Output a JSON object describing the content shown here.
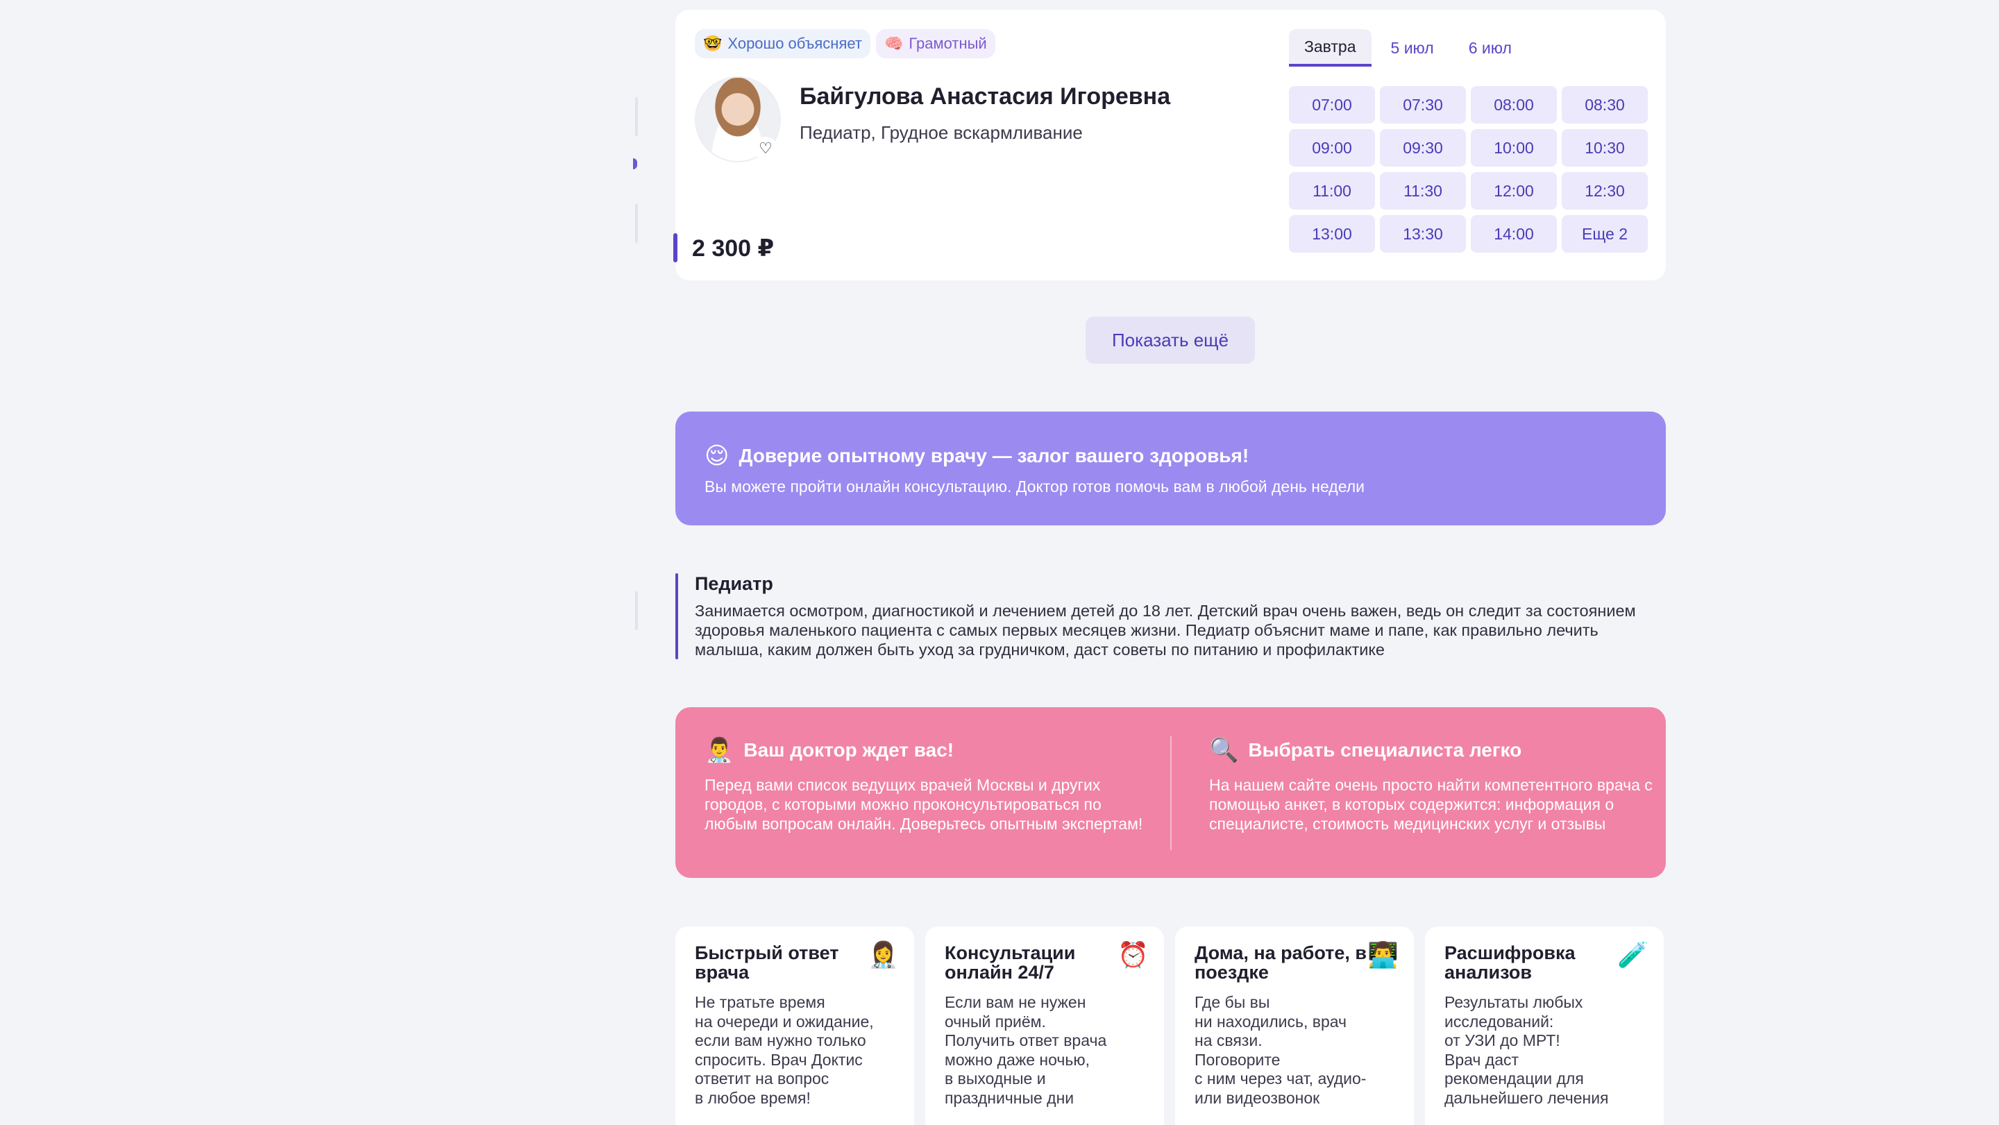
{
  "doctor": {
    "badges": [
      {
        "emoji": "🤓",
        "label": "Хорошо объясняет"
      },
      {
        "emoji": "🧠",
        "label": "Грамотный"
      }
    ],
    "name": "Байгулова Анастасия Игоревна",
    "specialty": "Педиатр, Грудное вскармливание",
    "price": "2 300 ₽",
    "favorite_icon": "heart-outline-icon",
    "tabs": [
      "Завтра",
      "5 июл",
      "6 июл"
    ],
    "active_tab": "Завтра",
    "slots": [
      "07:00",
      "07:30",
      "08:00",
      "08:30",
      "09:00",
      "09:30",
      "10:00",
      "10:30",
      "11:00",
      "11:30",
      "12:00",
      "12:30",
      "13:00",
      "13:30",
      "14:00",
      "Еще 2"
    ]
  },
  "show_more_label": "Показать ещё",
  "trust": {
    "emoji": "😌",
    "title": "Доверие опытному врачу — залог вашего здоровья!",
    "text": "Вы можете пройти онлайн консультацию. Доктор готов помочь вам в любой день недели"
  },
  "specialty_info": {
    "title": "Педиатр",
    "text": "Занимается осмотром, диагностикой и лечением детей до 18 лет. Детский врач очень важен, ведь он следит за состоянием здоровья маленького пациента с самых первых месяцев жизни. Педиатр объяснит маме и папе, как правильно лечить малыша, каким должен быть уход за грудничком, даст советы по питанию и профилактике"
  },
  "promo": {
    "left": {
      "emoji": "👨‍⚕️",
      "title": "Ваш доктор ждет вас!",
      "text": "Перед вами список ведущих врачей Москвы и других городов, с которыми можно проконсультироваться по любым вопросам онлайн. Доверьтесь опытным экспертам!"
    },
    "right": {
      "emoji": "🔍",
      "title": "Выбрать специалиста легко",
      "text": "На нашем сайте очень просто найти компетентного врача с помощью анкет, в которых содержится: информация о специалисте, стоимость медицинских услуг и отзывы"
    }
  },
  "features": [
    {
      "title": "Быстрый ответ врача",
      "emoji": "👩‍⚕️",
      "text": "Не тратьте время\nна очереди и ожидание,\nесли вам нужно только\nспросить. Врач Доктис\nответит на вопрос\nв любое время!"
    },
    {
      "title": "Консультации онлайн 24/7",
      "emoji": "⏰",
      "text": "Если вам не нужен\nочный приём.\nПолучить ответ врача\nможно даже ночью,\nв выходные и\nпраздничные дни"
    },
    {
      "title": "Дома, на работе, в поездке",
      "emoji": "👨‍💻",
      "text": "Где бы вы\nни находились, врач\nна связи.\nПоговорите\nс ним через чат, аудио-\nили видеозвонок"
    },
    {
      "title": "Расшифровка анализов",
      "emoji": "🧪",
      "text": "Результаты любых\nисследований:\nот УЗИ до МРТ!\nВрач даст\nрекомендации для\nдальнейшего лечения"
    }
  ]
}
